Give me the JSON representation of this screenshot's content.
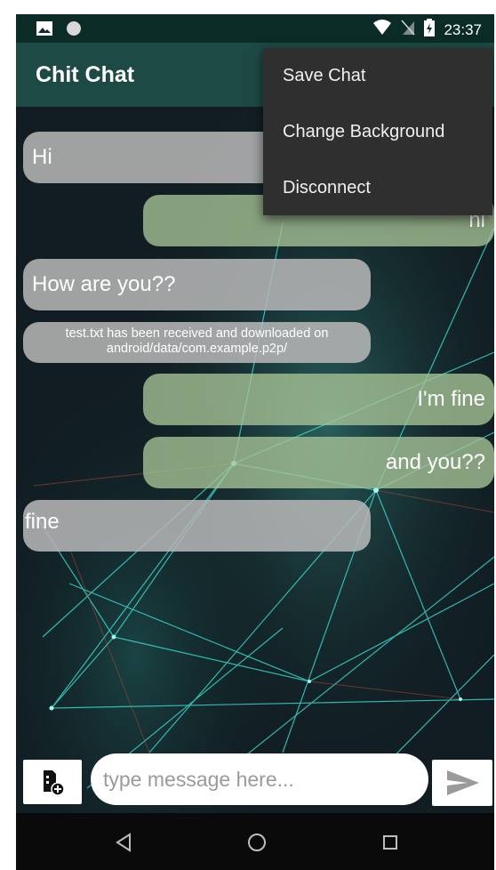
{
  "status_bar": {
    "time": "23:37",
    "left_icons": [
      "image-icon",
      "circle-icon"
    ],
    "right_icons": [
      "wifi-icon",
      "no-sim-icon",
      "battery-charging-icon"
    ]
  },
  "app_bar": {
    "title": "Chit Chat"
  },
  "menu": {
    "items": [
      {
        "label": "Save Chat"
      },
      {
        "label": "Change Background"
      },
      {
        "label": "Disconnect"
      }
    ]
  },
  "messages": [
    {
      "side": "incoming",
      "text": "Hi"
    },
    {
      "side": "outgoing",
      "text": "hi"
    },
    {
      "side": "incoming",
      "text": "How are you??"
    },
    {
      "side": "incoming",
      "kind": "file-notice",
      "text": "test.txt has been received and downloaded on android/data/com.example.p2p/"
    },
    {
      "side": "outgoing",
      "text": "I'm fine"
    },
    {
      "side": "outgoing",
      "text": "and you??"
    },
    {
      "side": "incoming",
      "text": "fine"
    }
  ],
  "composer": {
    "placeholder": "type message here...",
    "attach_icon": "attach-file-icon",
    "send_icon": "send-icon"
  },
  "nav_bar": {
    "icons": [
      "back-triangle-icon",
      "home-circle-icon",
      "recents-square-icon"
    ]
  },
  "colors": {
    "status_bar": "#0b2b26",
    "app_bar": "#1e4a45",
    "menu_bg": "#2f2f2f",
    "incoming_bubble": "#b8b8b8",
    "outgoing_bubble": "#a8c496",
    "accent_cyan": "#3ee8e0"
  }
}
